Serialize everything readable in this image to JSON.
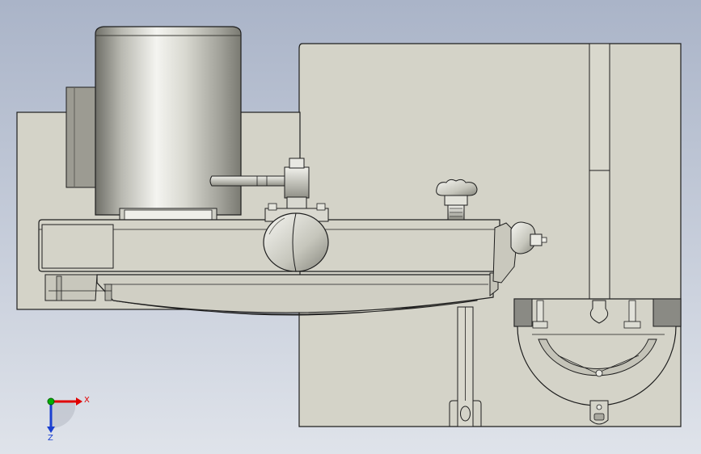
{
  "viewport": {
    "background_top": "#aab4c8",
    "background_bottom": "#dfe3ea"
  },
  "colors": {
    "part_fill": "#d4d3c8",
    "part_stroke": "#1e1e1e",
    "motor_light": "#f2f2ee",
    "motor_dark": "#6f6f68",
    "slot_fill": "#8a8a84",
    "axis_x": "#e00000",
    "axis_y": "#00b000",
    "axis_z": "#1a3fd0"
  },
  "triad": {
    "x_label": "X",
    "z_label": "Z"
  }
}
